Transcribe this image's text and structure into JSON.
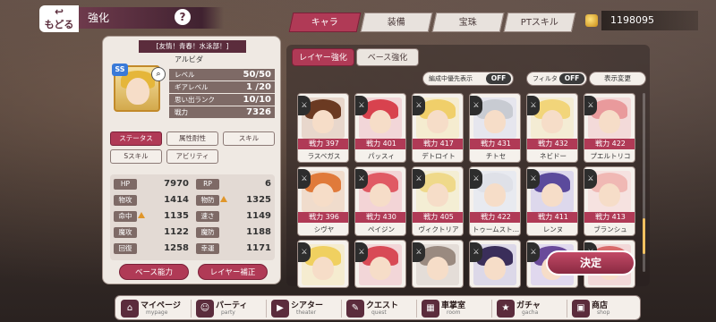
{
  "header": {
    "back_label": "もどる",
    "title": "強化",
    "help_label": "?",
    "tabs": [
      "キャラ",
      "装備",
      "宝珠",
      "PTスキル"
    ],
    "active_tab": "キャラ",
    "currency": "1198095"
  },
  "character": {
    "subtitle": "[友情！青春！水泳部！]",
    "name": "アルビダ",
    "rank_badge": "SS",
    "stats": [
      {
        "label": "レベル",
        "value": "50/50"
      },
      {
        "label": "ギアレベル",
        "value": "1 /20"
      },
      {
        "label": "思い出ランク",
        "value": "10/10"
      },
      {
        "label": "戦力",
        "value": "7326"
      }
    ]
  },
  "subtabs": [
    "ステータス",
    "属性耐性",
    "スキル",
    "Sスキル",
    "アビリティ"
  ],
  "active_subtab": "ステータス",
  "status_table": [
    {
      "label": "HP",
      "value": "7970",
      "up": false
    },
    {
      "label": "RP",
      "value": "6",
      "up": false
    },
    {
      "label": "物攻",
      "value": "1414",
      "up": false
    },
    {
      "label": "物防",
      "value": "1325",
      "up": true
    },
    {
      "label": "命中",
      "value": "1135",
      "up": true
    },
    {
      "label": "速さ",
      "value": "1149",
      "up": false
    },
    {
      "label": "魔攻",
      "value": "1122",
      "up": false
    },
    {
      "label": "魔防",
      "value": "1188",
      "up": false
    },
    {
      "label": "回復",
      "value": "1258",
      "up": false
    },
    {
      "label": "幸運",
      "value": "1171",
      "up": false
    }
  ],
  "bottom_buttons": [
    "ベース能力",
    "レイヤー補正"
  ],
  "right": {
    "layer_tabs": [
      "レイヤー強化",
      "ベース強化"
    ],
    "toggle_party": {
      "label": "編成中優先表示",
      "state": "OFF"
    },
    "toggle_filter": {
      "label": "フィルタ",
      "state": "OFF"
    },
    "display_change": "表示変更",
    "decide": "決定",
    "power_label": "戦力",
    "cards": [
      {
        "name": "ラスベガス",
        "power": "397",
        "hair": "#6b3a22",
        "bg": "#e8d7cc"
      },
      {
        "name": "パッスィ",
        "power": "401",
        "hair": "#d8424e",
        "bg": "#f2d6d8"
      },
      {
        "name": "デトロイト",
        "power": "417",
        "hair": "#f0cf6a",
        "bg": "#f5ecd0"
      },
      {
        "name": "チトセ",
        "power": "431",
        "hair": "#c8cbd2",
        "bg": "#e6e6ee"
      },
      {
        "name": "ネビドー",
        "power": "432",
        "hair": "#f2d57a",
        "bg": "#f4ecd4"
      },
      {
        "name": "プエルトリコ",
        "power": "422",
        "hair": "#e99a9c",
        "bg": "#f3dad9"
      },
      {
        "name": "シヴヤ",
        "power": "396",
        "hair": "#e07a3a",
        "bg": "#f0dccc"
      },
      {
        "name": "ペイジン",
        "power": "430",
        "hair": "#e05a64",
        "bg": "#f3d4d6"
      },
      {
        "name": "ヴィクトリア",
        "power": "405",
        "hair": "#efd98a",
        "bg": "#f4eed4"
      },
      {
        "name": "トゥームスト…",
        "power": "422",
        "hair": "#dfe1e8",
        "bg": "#e8eaf0"
      },
      {
        "name": "レンヌ",
        "power": "411",
        "hair": "#5b4a9c",
        "bg": "#ddd8ec"
      },
      {
        "name": "ブランシュ",
        "power": "413",
        "hair": "#f0b8b4",
        "bg": "#f6e2e0"
      },
      {
        "name": "",
        "power": "",
        "hair": "#f0d060",
        "bg": "#f5ecd0"
      },
      {
        "name": "",
        "power": "",
        "hair": "#d84a56",
        "bg": "#f2d6d8"
      },
      {
        "name": "",
        "power": "",
        "hair": "#9a8a80",
        "bg": "#e4ddd8"
      },
      {
        "name": "",
        "power": "",
        "hair": "#3a2e5a",
        "bg": "#dcd8e8"
      },
      {
        "name": "",
        "power": "",
        "hair": "#6a4a9a",
        "bg": "#e0d8ee"
      },
      {
        "name": "",
        "power": "",
        "hair": "#d86a6a",
        "bg": "#f2d8d8"
      }
    ]
  },
  "nav": [
    {
      "jp": "マイページ",
      "en": "mypage",
      "icon": "home-icon"
    },
    {
      "jp": "パーティ",
      "en": "party",
      "icon": "party-icon"
    },
    {
      "jp": "シアター",
      "en": "theater",
      "icon": "theater-icon"
    },
    {
      "jp": "クエスト",
      "en": "quest",
      "icon": "quest-icon"
    },
    {
      "jp": "車掌室",
      "en": "room",
      "icon": "room-icon"
    },
    {
      "jp": "ガチャ",
      "en": "gacha",
      "icon": "gacha-icon"
    },
    {
      "jp": "商店",
      "en": "shop",
      "icon": "shop-icon"
    }
  ],
  "colors": {
    "accent": "#b03a56",
    "dark": "#5b2c3c",
    "panel": "#efe9e3"
  }
}
